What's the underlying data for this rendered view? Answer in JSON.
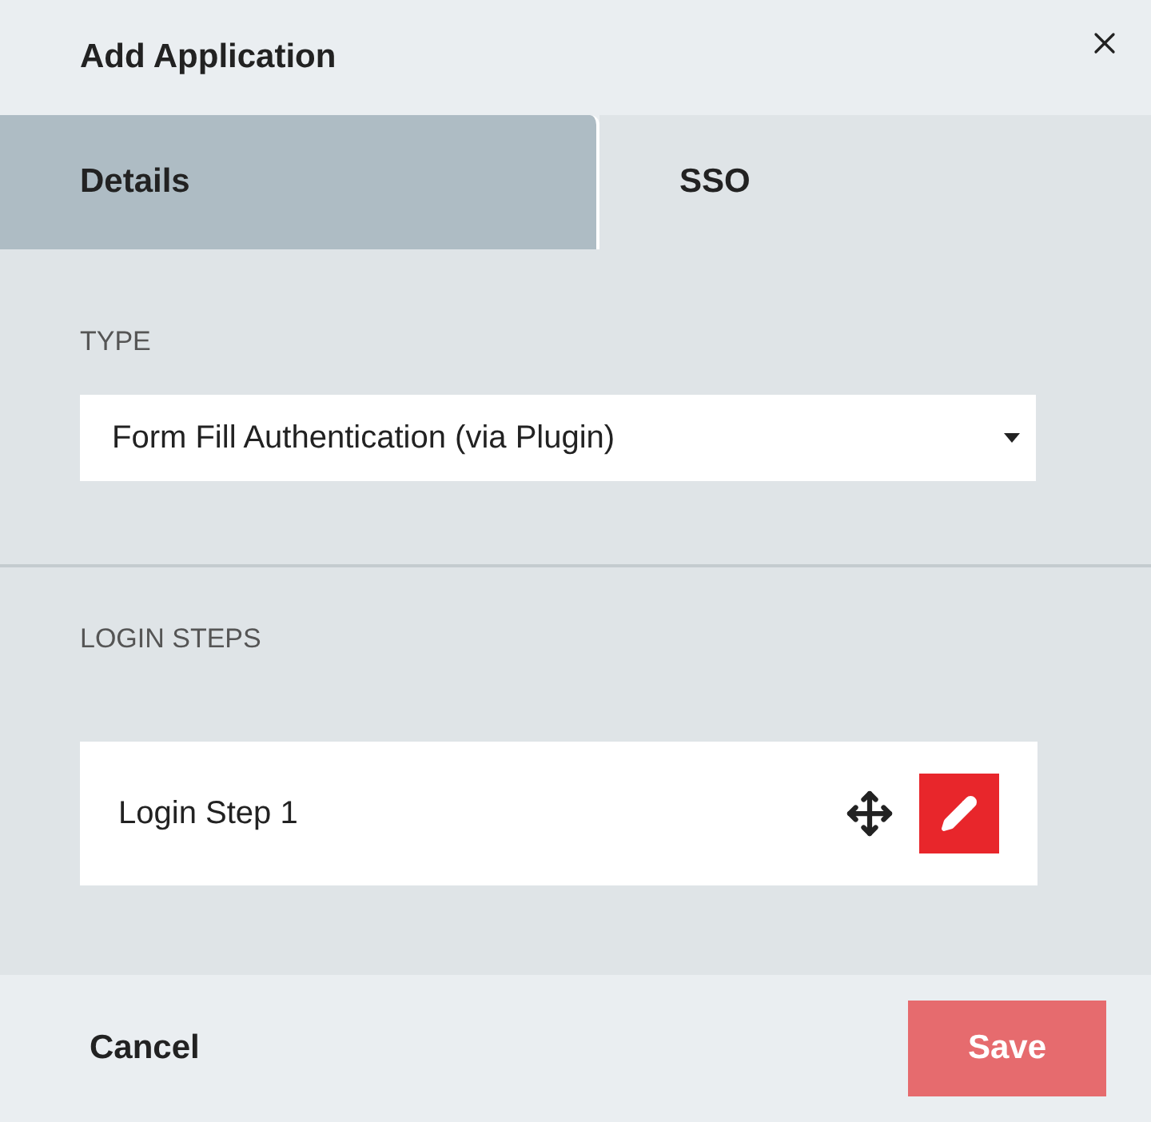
{
  "dialog": {
    "title": "Add Application"
  },
  "tabs": [
    {
      "label": "Details",
      "selected": true
    },
    {
      "label": "SSO",
      "selected": false
    }
  ],
  "type_section": {
    "label": "TYPE",
    "select_value": "Form Fill Authentication (via Plugin)"
  },
  "login_steps": {
    "label": "LOGIN STEPS",
    "steps": [
      {
        "name": "Login Step 1"
      }
    ]
  },
  "footer": {
    "cancel": "Cancel",
    "save": {
      "label": "Save",
      "disabled": true
    }
  }
}
